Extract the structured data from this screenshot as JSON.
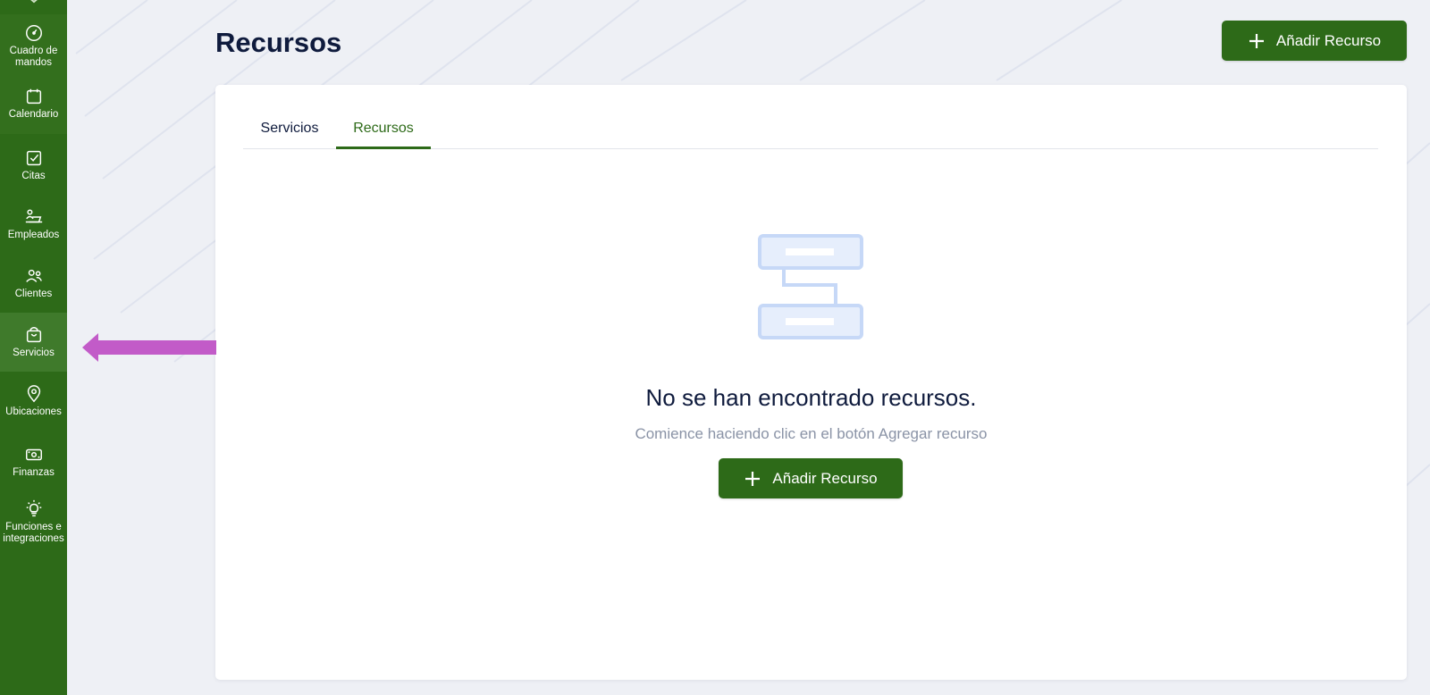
{
  "colors": {
    "brand": "#2d6a18",
    "sidebar_active": "#3f7a2b",
    "title_text": "#0f1b3d",
    "muted_text": "#8a93a6",
    "annotation_arrow": "#c25bc8"
  },
  "sidebar": {
    "items": [
      {
        "label": "Cuadro de\nmandos",
        "icon": "gauge-icon"
      },
      {
        "label": "Calendario",
        "icon": "calendar-icon"
      },
      {
        "label": "Citas",
        "icon": "check-square-icon"
      },
      {
        "label": "Empleados",
        "icon": "employee-desk-icon"
      },
      {
        "label": "Clientes",
        "icon": "users-icon"
      },
      {
        "label": "Servicios",
        "icon": "bag-icon",
        "active": true
      },
      {
        "label": "Ubicaciones",
        "icon": "map-pin-icon"
      },
      {
        "label": "Finanzas",
        "icon": "banknote-icon"
      },
      {
        "label": "Funciones e\nintegraciones",
        "icon": "lightbulb-icon"
      }
    ]
  },
  "header": {
    "title": "Recursos",
    "add_button_label": "Añadir Recurso"
  },
  "tabs": [
    {
      "label": "Servicios",
      "active": false
    },
    {
      "label": "Recursos",
      "active": true
    }
  ],
  "empty_state": {
    "title": "No se han encontrado recursos.",
    "subtitle": "Comience haciendo clic en el botón Agregar recurso",
    "button_label": "Añadir Recurso",
    "icon": "resource-hierarchy-icon"
  }
}
